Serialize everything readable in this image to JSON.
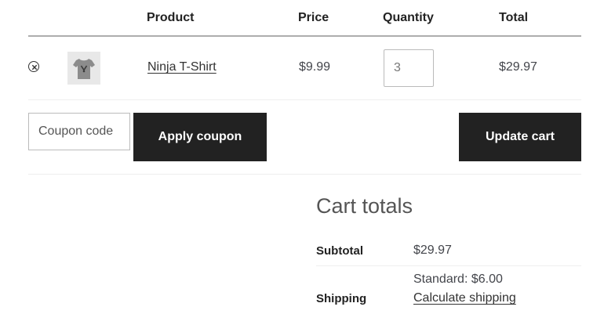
{
  "cart": {
    "headers": {
      "product": "Product",
      "price": "Price",
      "quantity": "Quantity",
      "total": "Total"
    },
    "items": [
      {
        "name": "Ninja T-Shirt",
        "price": "$9.99",
        "quantity": "3",
        "total": "$29.97",
        "remove_icon": "close-circle-icon",
        "thumbnail": "tshirt-thumbnail"
      }
    ]
  },
  "actions": {
    "coupon_placeholder": "Coupon code",
    "apply_coupon_label": "Apply coupon",
    "update_cart_label": "Update cart"
  },
  "totals": {
    "title": "Cart totals",
    "subtotal_label": "Subtotal",
    "subtotal_value": "$29.97",
    "shipping_label": "Shipping",
    "shipping_method": "Standard: $6.00",
    "calculate_shipping_label": "Calculate shipping"
  },
  "colors": {
    "button_bg": "#222222",
    "button_text": "#ffffff",
    "text": "#43454b",
    "heading": "#222222"
  }
}
